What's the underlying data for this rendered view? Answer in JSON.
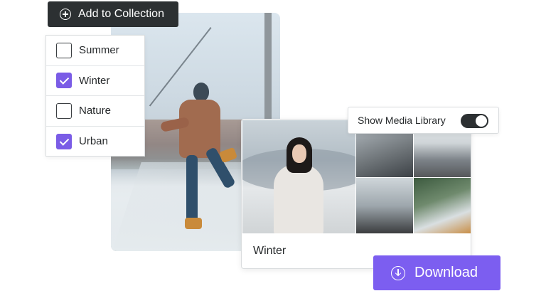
{
  "add_button": {
    "label": "Add to Collection",
    "icon": "plus-circle-icon"
  },
  "collections": [
    {
      "label": "Summer",
      "checked": false
    },
    {
      "label": "Winter",
      "checked": true
    },
    {
      "label": "Nature",
      "checked": false
    },
    {
      "label": "Urban",
      "checked": true
    }
  ],
  "toggle": {
    "label": "Show Media Library",
    "on": true
  },
  "media_card": {
    "title": "Winter"
  },
  "download_button": {
    "label": "Download",
    "icon": "download-circle-icon"
  },
  "colors": {
    "accent": "#7c5ef0",
    "dark": "#2c3032",
    "text": "#26292b",
    "border": "#d9dcde"
  }
}
